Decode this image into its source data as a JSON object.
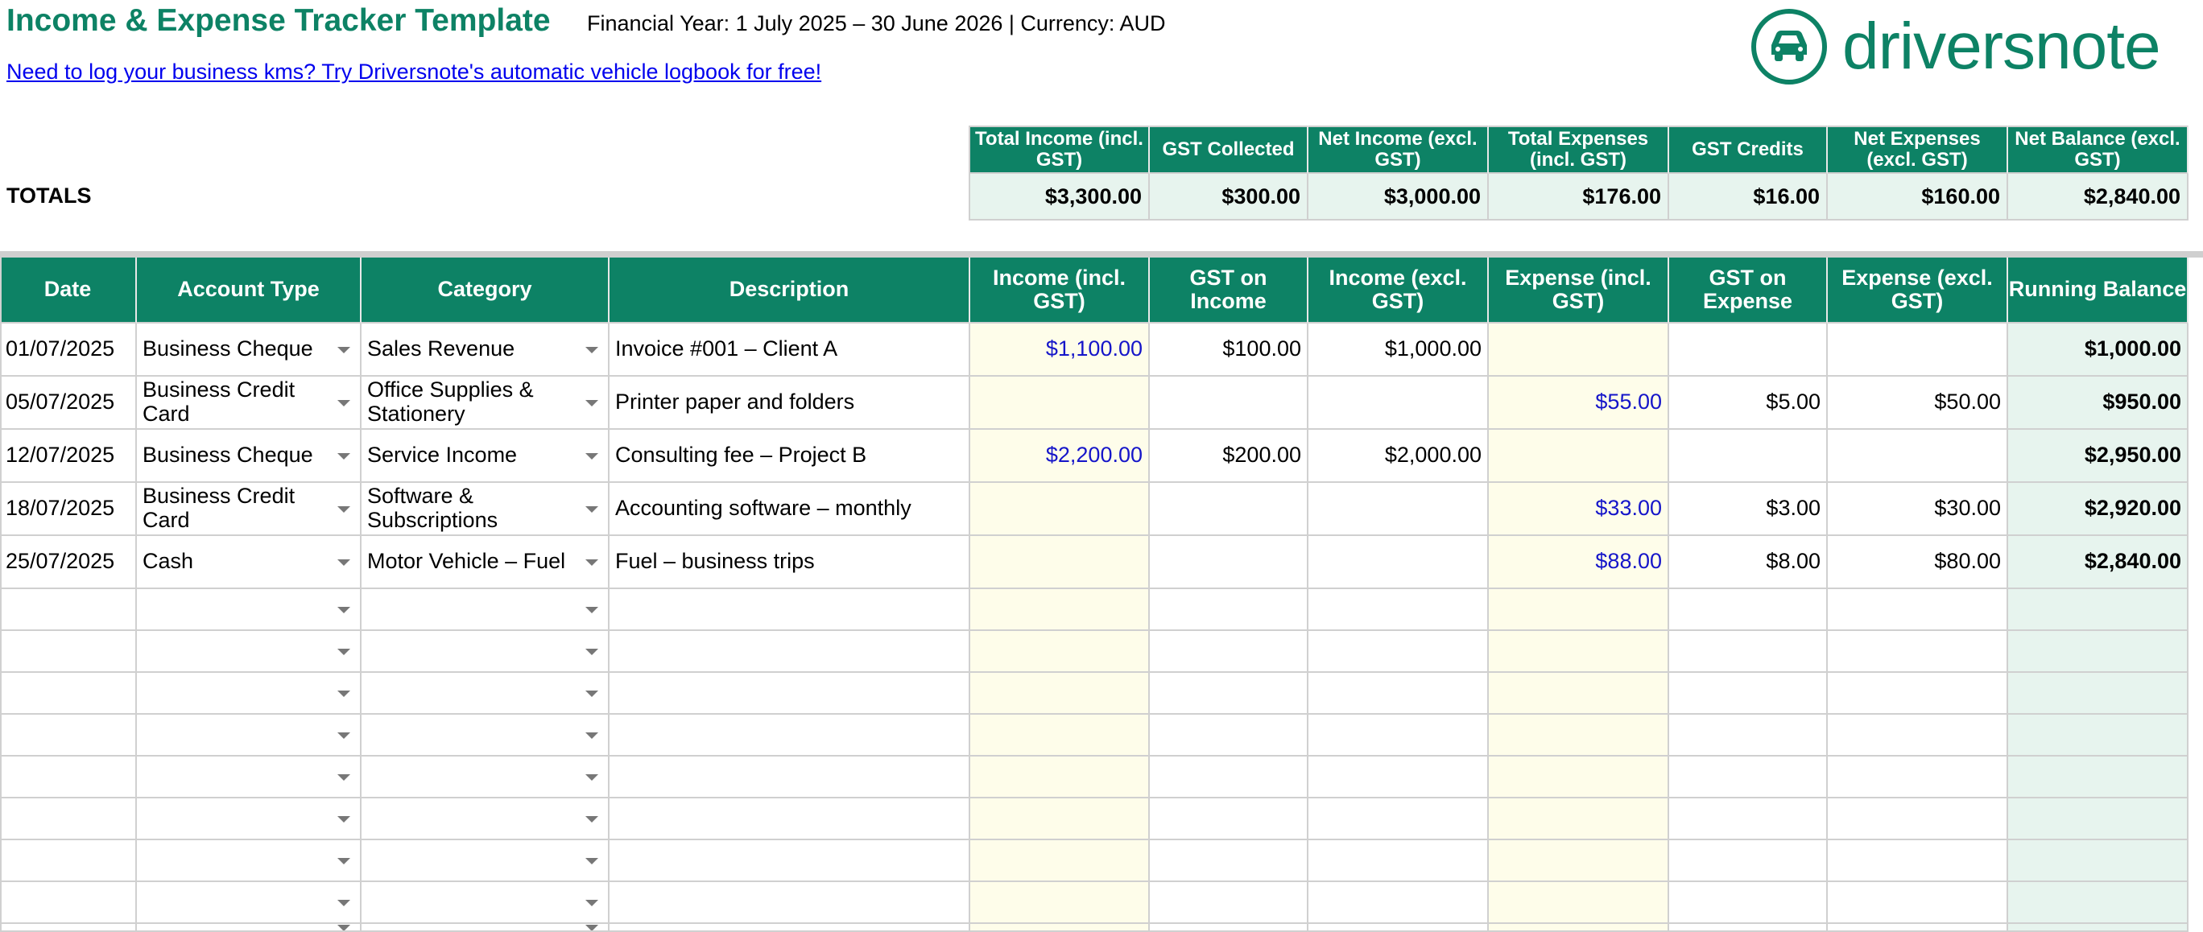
{
  "header": {
    "title": "Income & Expense Tracker Template",
    "subtitle": "Financial Year: 1 July 2025 – 30 June 2026   |   Currency: AUD",
    "promo_link": "Need to log your business kms? Try Driversnote's automatic vehicle logbook for free!",
    "logo_text": "driversnote",
    "logo_icon": "car-icon"
  },
  "totals": {
    "label": "TOTALS",
    "headers": [
      "Total Income (incl. GST)",
      "GST Collected",
      "Net Income (excl. GST)",
      "Total Expenses (incl. GST)",
      "GST Credits",
      "Net Expenses (excl. GST)",
      "Net Balance (excl. GST)"
    ],
    "values": [
      "$3,300.00",
      "$300.00",
      "$3,000.00",
      "$176.00",
      "$16.00",
      "$160.00",
      "$2,840.00"
    ]
  },
  "table": {
    "columns": [
      "Date",
      "Account Type",
      "Category",
      "Description",
      "Income (incl. GST)",
      "GST on Income",
      "Income (excl. GST)",
      "Expense (incl. GST)",
      "GST on Expense",
      "Expense (excl. GST)",
      "Running Balance"
    ],
    "rows": [
      {
        "date": "01/07/2025",
        "account": "Business Cheque",
        "category": "Sales Revenue",
        "description": "Invoice #001 – Client A",
        "income_incl": "$1,100.00",
        "gst_income": "$100.00",
        "income_excl": "$1,000.00",
        "expense_incl": "",
        "gst_expense": "",
        "expense_excl": "",
        "balance": "$1,000.00"
      },
      {
        "date": "05/07/2025",
        "account": "Business Credit Card",
        "category": "Office Supplies & Stationery",
        "description": "Printer paper and folders",
        "income_incl": "",
        "gst_income": "",
        "income_excl": "",
        "expense_incl": "$55.00",
        "gst_expense": "$5.00",
        "expense_excl": "$50.00",
        "balance": "$950.00"
      },
      {
        "date": "12/07/2025",
        "account": "Business Cheque",
        "category": "Service Income",
        "description": "Consulting fee – Project B",
        "income_incl": "$2,200.00",
        "gst_income": "$200.00",
        "income_excl": "$2,000.00",
        "expense_incl": "",
        "gst_expense": "",
        "expense_excl": "",
        "balance": "$2,950.00"
      },
      {
        "date": "18/07/2025",
        "account": "Business Credit Card",
        "category": "Software & Subscriptions",
        "description": "Accounting software – monthly",
        "income_incl": "",
        "gst_income": "",
        "income_excl": "",
        "expense_incl": "$33.00",
        "gst_expense": "$3.00",
        "expense_excl": "$30.00",
        "balance": "$2,920.00"
      },
      {
        "date": "25/07/2025",
        "account": "Cash",
        "category": "Motor Vehicle – Fuel",
        "description": "Fuel – business trips",
        "income_incl": "",
        "gst_income": "",
        "income_excl": "",
        "expense_incl": "$88.00",
        "gst_expense": "$8.00",
        "expense_excl": "$80.00",
        "balance": "$2,840.00"
      }
    ],
    "empty_row_count": 9
  },
  "colors": {
    "brand_green": "#0d8265",
    "income_input": "#fefdea",
    "balance_fill": "#e7f4ee",
    "input_text": "#1515c9",
    "link": "#0000ee"
  }
}
